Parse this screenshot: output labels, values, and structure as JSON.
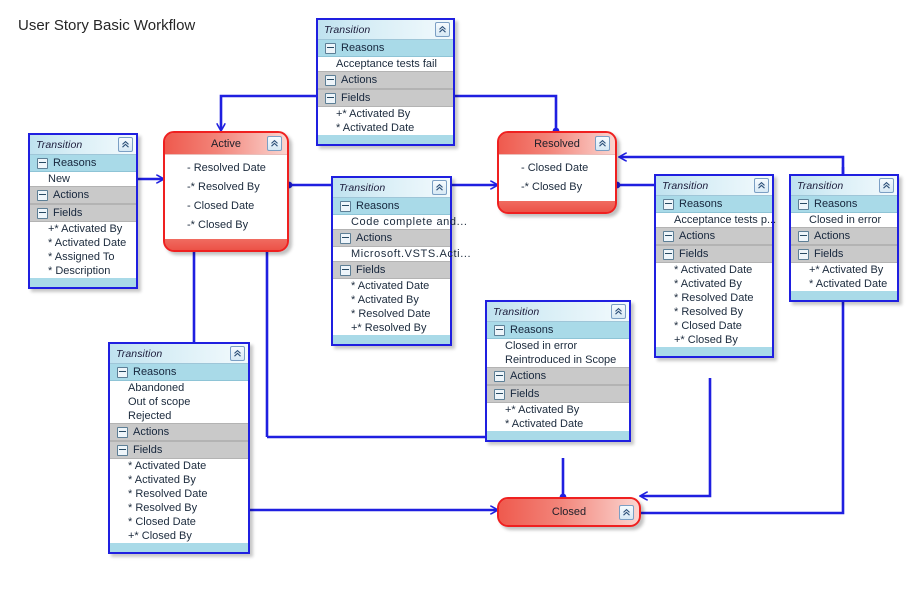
{
  "title": "User Story Basic Workflow",
  "icons": {
    "collapse": "chevron-double-up-icon",
    "expander": "minus-square-icon"
  },
  "section_labels": {
    "reasons": "Reasons",
    "actions": "Actions",
    "fields": "Fields"
  },
  "box_title": "Transition",
  "states": [
    {
      "id": "active",
      "name": "Active",
      "fields": [
        "- Resolved Date",
        "-* Resolved By",
        "- Closed Date",
        "-* Closed By"
      ]
    },
    {
      "id": "resolved",
      "name": "Resolved",
      "fields": [
        "- Closed Date",
        "-* Closed By"
      ]
    },
    {
      "id": "closed",
      "name": "Closed",
      "fields": []
    }
  ],
  "transitions": [
    {
      "id": "t-new",
      "reasons": [
        "New"
      ],
      "actions": [],
      "fields": [
        "+* Activated By",
        "* Activated Date",
        "* Assigned To",
        "* Description"
      ]
    },
    {
      "id": "t-acceptance-tests-fail",
      "reasons": [
        "Acceptance tests fail"
      ],
      "actions": [],
      "fields": [
        "+* Activated By",
        "* Activated Date"
      ]
    },
    {
      "id": "t-code-complete",
      "reasons": [
        "Code complete and..."
      ],
      "actions": [
        "Microsoft.VSTS.Acti..."
      ],
      "fields": [
        "* Activated Date",
        "* Activated By",
        "* Resolved Date",
        "+* Resolved By"
      ]
    },
    {
      "id": "t-abandoned",
      "reasons": [
        "Abandoned",
        "Out of scope",
        "Rejected"
      ],
      "actions": [],
      "fields": [
        "* Activated Date",
        "* Activated By",
        "* Resolved Date",
        "* Resolved By",
        "* Closed Date",
        "+* Closed By"
      ]
    },
    {
      "id": "t-closed-in-error-reintroduced",
      "reasons": [
        "Closed in error",
        "Reintroduced in Scope"
      ],
      "actions": [],
      "fields": [
        "+* Activated By",
        "* Activated Date"
      ]
    },
    {
      "id": "t-acceptance-tests-pass",
      "reasons": [
        "Acceptance  tests  p..."
      ],
      "actions": [],
      "fields": [
        "* Activated Date",
        "* Activated By",
        "* Resolved Date",
        "* Resolved By",
        "* Closed Date",
        "+* Closed By"
      ]
    },
    {
      "id": "t-closed-in-error",
      "reasons": [
        "Closed in error"
      ],
      "actions": [],
      "fields": [
        "+* Activated By",
        "* Activated Date"
      ]
    }
  ],
  "colors": {
    "connector": "#1f1fe0",
    "state_border": "#ef2020",
    "box_border": "#1f1fe0",
    "reasons_band": "#a9dae8",
    "section_band": "#c9c9c9"
  }
}
